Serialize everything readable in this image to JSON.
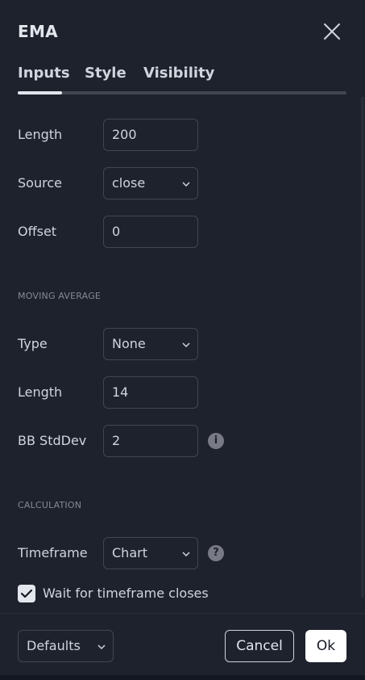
{
  "dialog": {
    "title": "EMA"
  },
  "tabs": [
    {
      "label": "Inputs",
      "active": true
    },
    {
      "label": "Style",
      "active": false
    },
    {
      "label": "Visibility",
      "active": false
    }
  ],
  "inputs": {
    "length": {
      "label": "Length",
      "value": "200"
    },
    "source": {
      "label": "Source",
      "value": "close"
    },
    "offset": {
      "label": "Offset",
      "value": "0"
    }
  },
  "moving_average": {
    "section_title": "MOVING AVERAGE",
    "type": {
      "label": "Type",
      "value": "None"
    },
    "length": {
      "label": "Length",
      "value": "14"
    },
    "bb_stddev": {
      "label": "BB StdDev",
      "value": "2"
    }
  },
  "calculation": {
    "section_title": "CALCULATION",
    "timeframe": {
      "label": "Timeframe",
      "value": "Chart"
    },
    "wait_for_close": {
      "label": "Wait for timeframe closes",
      "checked": true
    }
  },
  "footer": {
    "defaults_label": "Defaults",
    "cancel_label": "Cancel",
    "ok_label": "Ok"
  },
  "icons": {
    "close": "close-icon",
    "chevron": "chevron-down-icon",
    "info": "info-icon",
    "check": "check-icon"
  },
  "colors": {
    "background": "#1e222d",
    "text": "#d1d4dc",
    "border": "#434651",
    "accent": "#ffffff"
  }
}
